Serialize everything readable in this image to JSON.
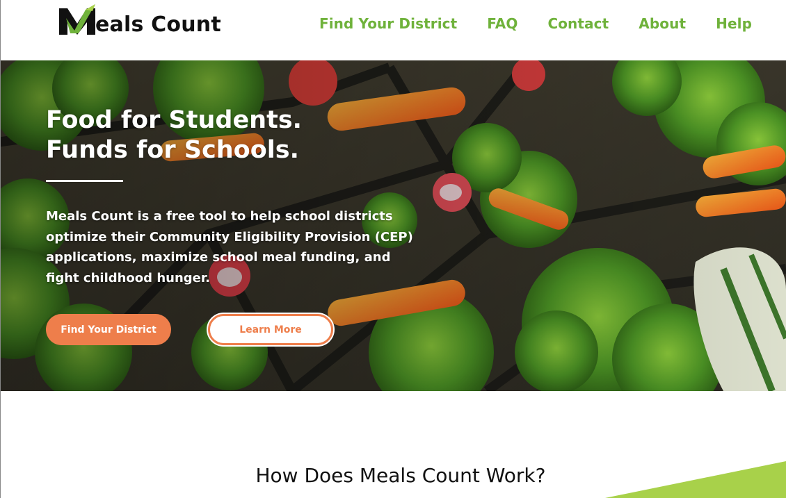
{
  "brand": {
    "name": "Meals Count",
    "logo_mark_letter": "M",
    "colors": {
      "green": "#6fb23b",
      "lime": "#a8d14a",
      "orange": "#ee7e4b",
      "dark": "#111111"
    }
  },
  "nav": {
    "items": [
      {
        "label": "Find Your District"
      },
      {
        "label": "FAQ"
      },
      {
        "label": "Contact"
      },
      {
        "label": "About"
      },
      {
        "label": "Help"
      }
    ]
  },
  "hero": {
    "title_line1": "Food for Students.",
    "title_line2": "Funds for Schools.",
    "description": "Meals Count is a free tool to help school districts optimize their Community Eligibility Provision (CEP) applications, maximize school meal funding, and fight childhood hunger.",
    "primary_button": "Find Your District",
    "secondary_button": "Learn More",
    "background_image": "school meal trays with broccoli, carrots and radishes"
  },
  "how_it_works": {
    "title": "How Does Meals Count Work?"
  }
}
